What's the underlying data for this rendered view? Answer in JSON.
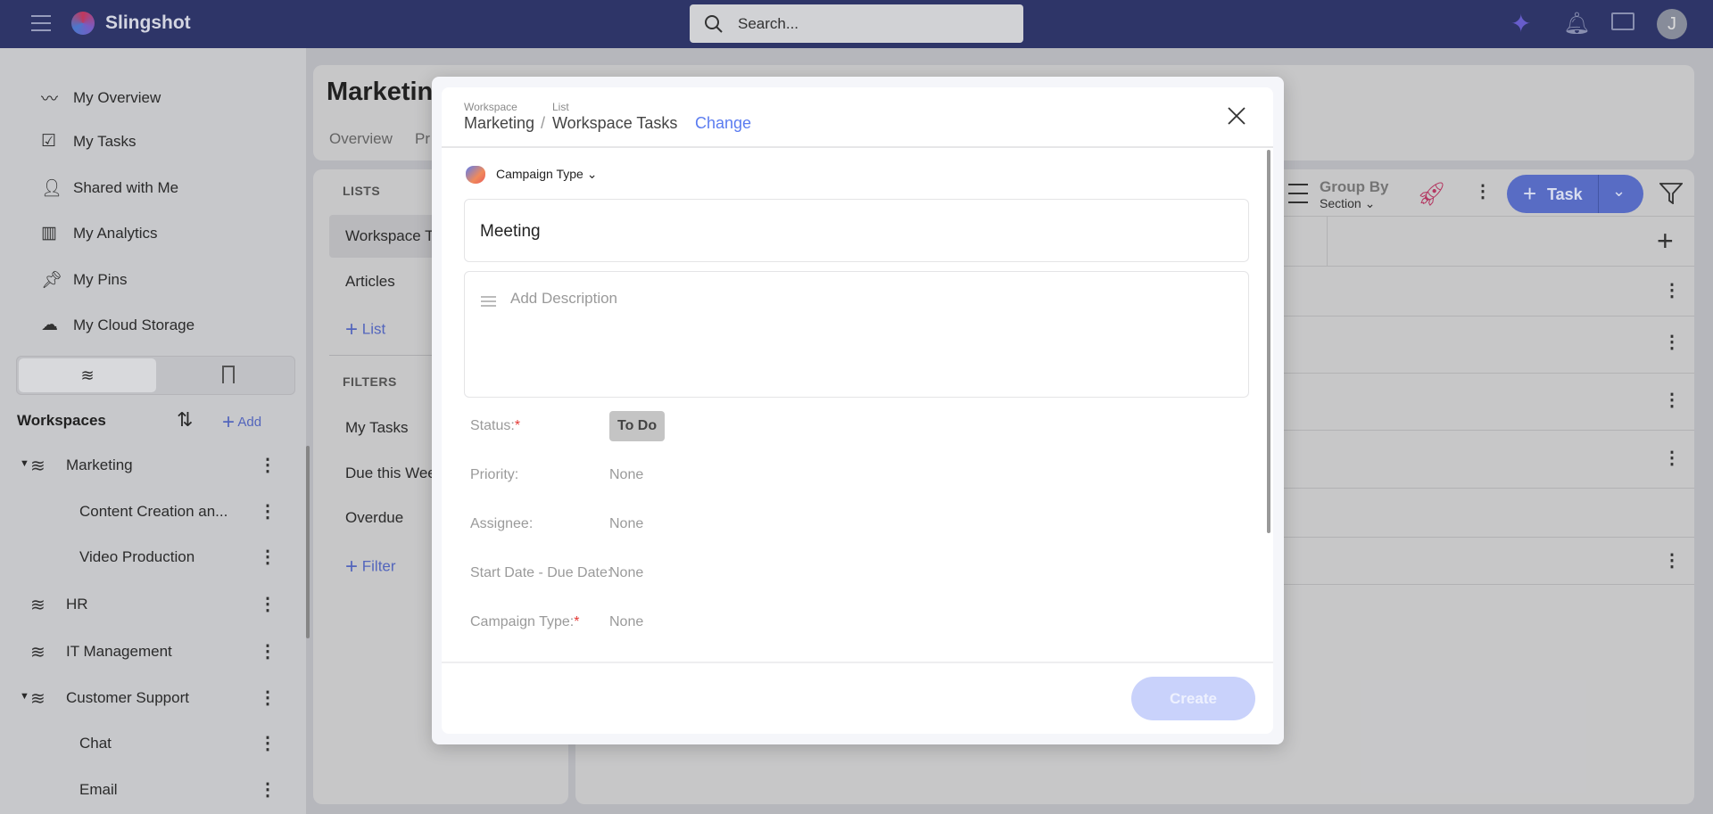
{
  "app": {
    "name": "Slingshot",
    "search_placeholder": "Search...",
    "avatar_initial": "J"
  },
  "sidebar": {
    "items": [
      {
        "label": "My Overview",
        "icon": "activity-icon"
      },
      {
        "label": "My Tasks",
        "icon": "clipboard-check-icon"
      },
      {
        "label": "Shared with Me",
        "icon": "user-check-icon"
      },
      {
        "label": "My Analytics",
        "icon": "bar-chart-icon"
      },
      {
        "label": "My Pins",
        "icon": "pin-icon"
      },
      {
        "label": "My Cloud Storage",
        "icon": "cloud-icon"
      }
    ],
    "workspaces_label": "Workspaces",
    "add_label": "Add",
    "tree": [
      {
        "label": "Marketing",
        "level": 0,
        "expanded": true
      },
      {
        "label": "Content Creation an...",
        "level": 1
      },
      {
        "label": "Video Production",
        "level": 1
      },
      {
        "label": "HR",
        "level": 0
      },
      {
        "label": "IT Management",
        "level": 0
      },
      {
        "label": "Customer Support",
        "level": 0,
        "expanded": true
      },
      {
        "label": "Chat",
        "level": 1
      },
      {
        "label": "Email",
        "level": 1
      }
    ]
  },
  "workspace": {
    "title": "Marketin",
    "tabs": [
      "Overview",
      "Pr"
    ]
  },
  "lists": {
    "lists_label": "LISTS",
    "items": [
      "Workspace T",
      "Articles"
    ],
    "add_list": "List",
    "filters_label": "FILTERS",
    "filters": [
      "My Tasks",
      "Due this Wee",
      "Overdue"
    ],
    "add_filter": "Filter"
  },
  "toolbar": {
    "group_by": "Group By",
    "group_value": "Section",
    "task_button": "Task"
  },
  "modal": {
    "workspace_caption": "Workspace",
    "workspace": "Marketing",
    "list_caption": "List",
    "list": "Workspace Tasks",
    "change": "Change",
    "type_selector": "Campaign Type",
    "title_value": "Meeting",
    "description_placeholder": "Add Description",
    "fields": [
      {
        "label": "Status:",
        "required": true,
        "value": "To Do",
        "badge": true
      },
      {
        "label": "Priority:",
        "value": "None"
      },
      {
        "label": "Assignee:",
        "value": "None"
      },
      {
        "label": "Start Date - Due Date:",
        "value": "None"
      },
      {
        "label": "Campaign Type:",
        "required": true,
        "value": "None"
      }
    ],
    "create": "Create"
  },
  "colors": {
    "accent": "#5a6fcc",
    "topbar": "#2f376b",
    "required": "#e53935"
  }
}
